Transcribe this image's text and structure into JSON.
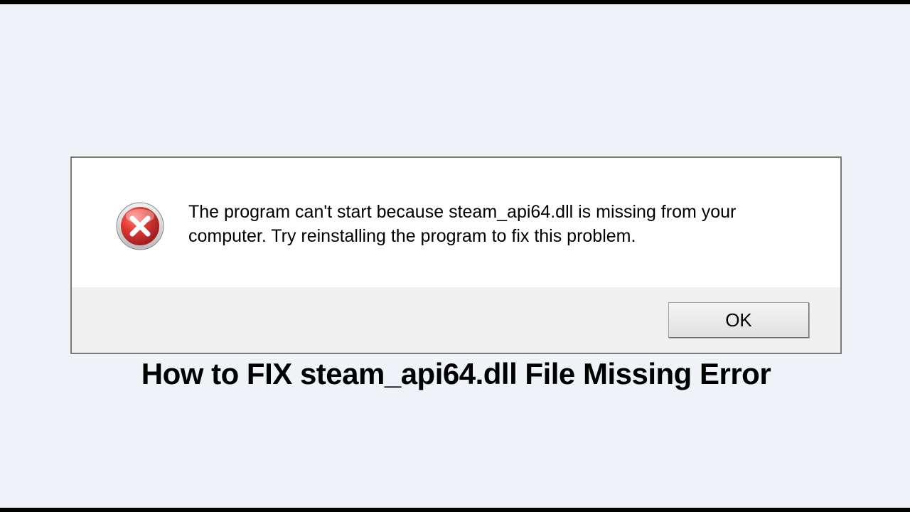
{
  "dialog": {
    "message": "The program can't start because steam_api64.dll is missing from your computer. Try reinstalling the program to fix this problem.",
    "ok_label": "OK"
  },
  "caption": "How to FIX steam_api64.dll File Missing Error",
  "colors": {
    "background": "#eff2f7",
    "error_red": "#d6302e",
    "error_dark": "#a11f1f"
  }
}
